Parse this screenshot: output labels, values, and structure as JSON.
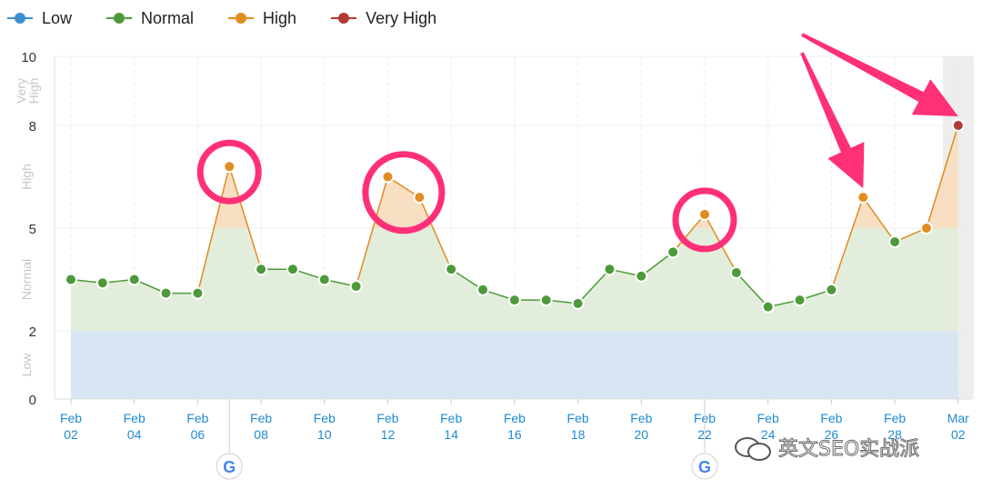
{
  "legend": [
    {
      "label": "Low",
      "color": "#3d8fd0"
    },
    {
      "label": "Normal",
      "color": "#4e9a3a"
    },
    {
      "label": "High",
      "color": "#e08c1f"
    },
    {
      "label": "Very High",
      "color": "#b23a32"
    }
  ],
  "colors": {
    "low_band": "#d8e6f4",
    "normal_area": "#e2eedb",
    "high_area": "#f8dfc4",
    "grid": "#ececec",
    "axis_text": "#1f8ad0",
    "annotation": "#ff2f78",
    "highlight_column": "#ededed"
  },
  "chart_data": {
    "type": "line",
    "ylim": [
      0,
      10
    ],
    "y_ticks": [
      0,
      2,
      5,
      8,
      10
    ],
    "y_band_labels": [
      {
        "label": "Very High",
        "from": 8,
        "to": 10
      },
      {
        "label": "High",
        "from": 5,
        "to": 8
      },
      {
        "label": "Normal",
        "from": 2,
        "to": 5
      },
      {
        "label": "Low",
        "from": 0,
        "to": 2
      }
    ],
    "x_tick_labels": [
      {
        "month": "Feb",
        "day": "02"
      },
      {
        "month": "Feb",
        "day": "04"
      },
      {
        "month": "Feb",
        "day": "06"
      },
      {
        "month": "Feb",
        "day": "08"
      },
      {
        "month": "Feb",
        "day": "10"
      },
      {
        "month": "Feb",
        "day": "12"
      },
      {
        "month": "Feb",
        "day": "14"
      },
      {
        "month": "Feb",
        "day": "16"
      },
      {
        "month": "Feb",
        "day": "18"
      },
      {
        "month": "Feb",
        "day": "20"
      },
      {
        "month": "Feb",
        "day": "22"
      },
      {
        "month": "Feb",
        "day": "24"
      },
      {
        "month": "Feb",
        "day": "26"
      },
      {
        "month": "Feb",
        "day": "28"
      },
      {
        "month": "Mar",
        "day": "02"
      }
    ],
    "series": [
      {
        "x": [
          "Feb 02",
          "Feb 03",
          "Feb 04",
          "Feb 05",
          "Feb 06",
          "Feb 07",
          "Feb 08",
          "Feb 09",
          "Feb 10",
          "Feb 11",
          "Feb 12",
          "Feb 13",
          "Feb 14",
          "Feb 15",
          "Feb 16",
          "Feb 17",
          "Feb 18",
          "Feb 19",
          "Feb 20",
          "Feb 21",
          "Feb 22",
          "Feb 23",
          "Feb 24",
          "Feb 25",
          "Feb 26",
          "Feb 27",
          "Feb 28",
          "Mar 01",
          "Mar 02"
        ],
        "values": [
          3.5,
          3.4,
          3.5,
          3.1,
          3.1,
          6.8,
          3.8,
          3.8,
          3.5,
          3.3,
          6.5,
          5.9,
          3.8,
          3.2,
          2.9,
          2.9,
          2.8,
          3.8,
          3.6,
          4.3,
          5.4,
          3.7,
          2.7,
          2.9,
          3.2,
          5.9,
          4.6,
          5.0,
          8.0
        ],
        "levels": [
          "Normal",
          "Normal",
          "Normal",
          "Normal",
          "Normal",
          "High",
          "Normal",
          "Normal",
          "Normal",
          "Normal",
          "High",
          "High",
          "Normal",
          "Normal",
          "Normal",
          "Normal",
          "Normal",
          "Normal",
          "Normal",
          "Normal",
          "High",
          "Normal",
          "Normal",
          "Normal",
          "Normal",
          "High",
          "Normal",
          "High",
          "Very High"
        ]
      }
    ],
    "google_update_markers": [
      "Feb 07",
      "Feb 22"
    ],
    "annotation_circles": [
      "Feb 07",
      "Feb 12 – Feb 13",
      "Feb 22"
    ],
    "annotation_arrows": [
      "Feb 27",
      "Mar 02"
    ],
    "highlighted_date": "Mar 02",
    "grid": true,
    "legend_position": "top-left"
  },
  "watermark": {
    "text": "英文SEO实战派"
  }
}
